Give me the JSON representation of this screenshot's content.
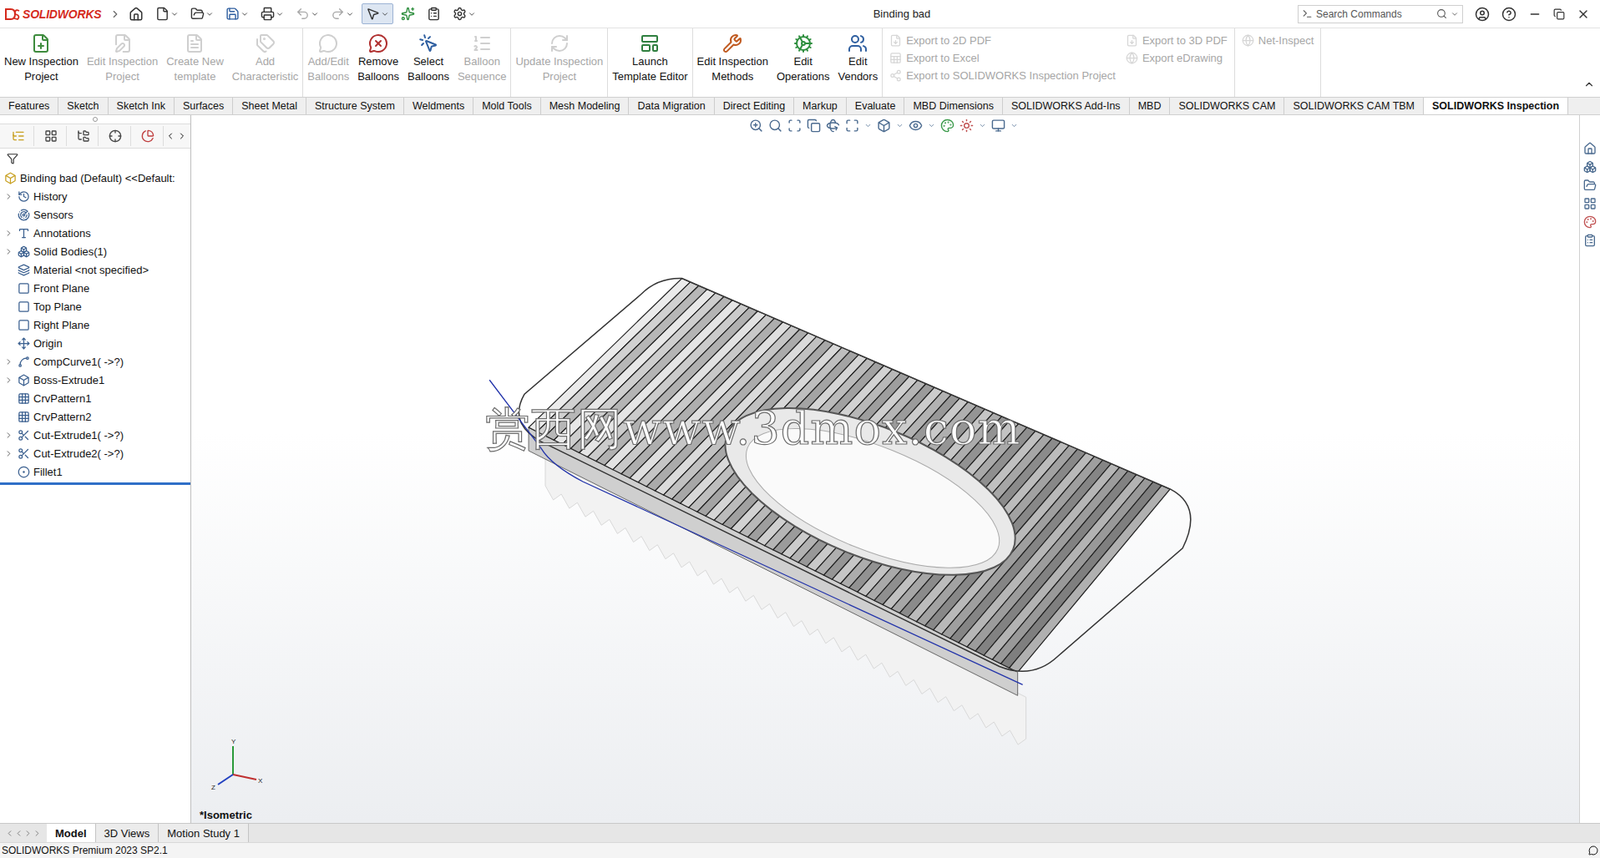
{
  "window": {
    "title": "Binding bad",
    "logo": "SOLIDWORKS"
  },
  "search": {
    "placeholder": "Search Commands"
  },
  "ribbon": {
    "groups": [
      [
        {
          "lines": [
            "New Inspection",
            "Project"
          ],
          "disabled": false
        },
        {
          "lines": [
            "Edit Inspection",
            "Project"
          ],
          "disabled": true
        },
        {
          "lines": [
            "Create New",
            "template"
          ],
          "disabled": true
        },
        {
          "lines": [
            "Add",
            "Characteristic"
          ],
          "disabled": true
        }
      ],
      [
        {
          "lines": [
            "Add/Edit",
            "Balloons"
          ],
          "disabled": true
        },
        {
          "lines": [
            "Remove",
            "Balloons"
          ],
          "disabled": false
        },
        {
          "lines": [
            "Select",
            "Balloons"
          ],
          "disabled": false
        },
        {
          "lines": [
            "Balloon",
            "Sequence"
          ],
          "disabled": true
        }
      ],
      [
        {
          "lines": [
            "Update Inspection",
            "Project"
          ],
          "disabled": true
        }
      ],
      [
        {
          "lines": [
            "Launch",
            "Template Editor"
          ],
          "disabled": false
        }
      ],
      [
        {
          "lines": [
            "Edit Inspection",
            "Methods"
          ],
          "disabled": false
        },
        {
          "lines": [
            "Edit",
            "Operations"
          ],
          "disabled": false
        },
        {
          "lines": [
            "Edit",
            "Vendors"
          ],
          "disabled": false
        }
      ]
    ],
    "export_items": [
      {
        "label": "Export to 2D PDF",
        "disabled": true
      },
      {
        "label": "Export to Excel",
        "disabled": true
      },
      {
        "label": "Export to SOLIDWORKS Inspection Project",
        "disabled": true
      },
      {
        "label": "Export to 3D PDF",
        "disabled": true
      },
      {
        "label": "Export eDrawing",
        "disabled": true
      }
    ],
    "extra_items": [
      {
        "label": "Net-Inspect",
        "disabled": true
      }
    ]
  },
  "tabs": [
    {
      "label": "Features",
      "selected": false
    },
    {
      "label": "Sketch",
      "selected": false
    },
    {
      "label": "Sketch Ink",
      "selected": false
    },
    {
      "label": "Surfaces",
      "selected": false
    },
    {
      "label": "Sheet Metal",
      "selected": false
    },
    {
      "label": "Structure System",
      "selected": false
    },
    {
      "label": "Weldments",
      "selected": false
    },
    {
      "label": "Mold Tools",
      "selected": false
    },
    {
      "label": "Mesh Modeling",
      "selected": false
    },
    {
      "label": "Data Migration",
      "selected": false
    },
    {
      "label": "Direct Editing",
      "selected": false
    },
    {
      "label": "Markup",
      "selected": false
    },
    {
      "label": "Evaluate",
      "selected": false
    },
    {
      "label": "MBD Dimensions",
      "selected": false
    },
    {
      "label": "SOLIDWORKS Add-Ins",
      "selected": false
    },
    {
      "label": "MBD",
      "selected": false
    },
    {
      "label": "SOLIDWORKS CAM",
      "selected": false
    },
    {
      "label": "SOLIDWORKS CAM TBM",
      "selected": false
    },
    {
      "label": "SOLIDWORKS Inspection",
      "selected": true
    }
  ],
  "feature_tree": {
    "root": "Binding bad (Default) <<Default:",
    "items": [
      {
        "label": "History",
        "expandable": true
      },
      {
        "label": "Sensors",
        "expandable": false
      },
      {
        "label": "Annotations",
        "expandable": true
      },
      {
        "label": "Solid Bodies(1)",
        "expandable": true
      },
      {
        "label": "Material <not specified>",
        "expandable": false
      },
      {
        "label": "Front Plane",
        "expandable": false
      },
      {
        "label": "Top Plane",
        "expandable": false
      },
      {
        "label": "Right Plane",
        "expandable": false
      },
      {
        "label": "Origin",
        "expandable": false
      },
      {
        "label": "CompCurve1( ->?)",
        "expandable": true
      },
      {
        "label": "Boss-Extrude1",
        "expandable": true
      },
      {
        "label": "CrvPattern1",
        "expandable": false
      },
      {
        "label": "CrvPattern2",
        "expandable": false
      },
      {
        "label": "Cut-Extrude1( ->?)",
        "expandable": true
      },
      {
        "label": "Cut-Extrude2( ->?)",
        "expandable": true
      },
      {
        "label": "Fillet1",
        "expandable": false
      }
    ]
  },
  "watermark": "赏西网www.3dmox.com",
  "triad": {
    "labels": [
      "Y",
      "X",
      "Z"
    ]
  },
  "view_label": "*Isometric",
  "bottom_tabs": [
    {
      "label": "Model",
      "selected": true
    },
    {
      "label": "3D Views",
      "selected": false
    },
    {
      "label": "Motion Study 1",
      "selected": false
    }
  ],
  "status_bar": "SOLIDWORKS Premium 2023 SP2.1"
}
